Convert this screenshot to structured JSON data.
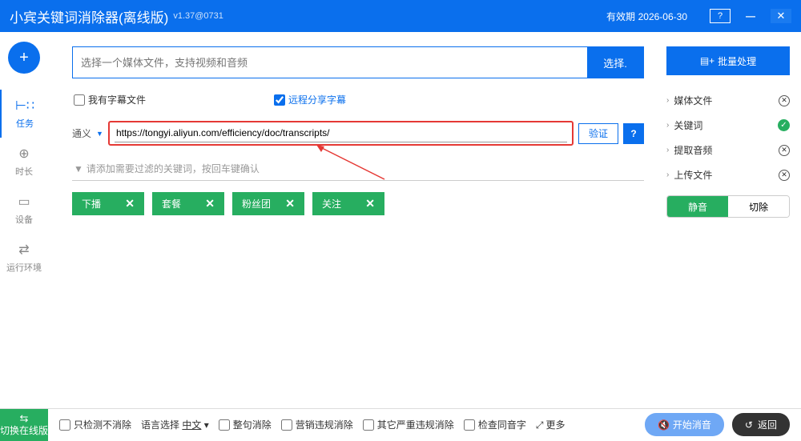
{
  "titlebar": {
    "title": "小宾关键词消除器(离线版)",
    "version": "v1.37@0731",
    "expiry_label": "有效期",
    "expiry_date": "2026-06-30"
  },
  "leftnav": {
    "items": [
      {
        "label": "任务"
      },
      {
        "label": "时长"
      },
      {
        "label": "设备"
      },
      {
        "label": "运行环境"
      }
    ]
  },
  "center": {
    "file_placeholder": "选择一个媒体文件，支持视频和音频",
    "select_btn": "选择.",
    "cb_subtitle": "我有字幕文件",
    "cb_remote": "远程分享字幕",
    "url_label": "通义",
    "url_value": "https://tongyi.aliyun.com/efficiency/doc/transcripts/",
    "verify": "验证",
    "kw_placeholder": "请添加需要过滤的关键词，按回车键确认",
    "tags": [
      "下播",
      "套餐",
      "粉丝团",
      "关注"
    ]
  },
  "right": {
    "batch": "批量处理",
    "steps": [
      {
        "label": "媒体文件",
        "status": "cancel"
      },
      {
        "label": "关键词",
        "status": "ok"
      },
      {
        "label": "提取音频",
        "status": "cancel"
      },
      {
        "label": "上传文件",
        "status": "cancel"
      }
    ],
    "toggle": {
      "mute": "静音",
      "cut": "切除"
    }
  },
  "bottom": {
    "switch": "切换在线版",
    "cb_detect": "只检测不消除",
    "lang_label": "语言选择",
    "lang_value": "中文",
    "cb_sentence": "整句消除",
    "cb_marketing": "营销违规消除",
    "cb_other": "其它严重违规消除",
    "cb_homo": "检查同音字",
    "more": "更多",
    "start": "开始消音",
    "back": "返回"
  }
}
